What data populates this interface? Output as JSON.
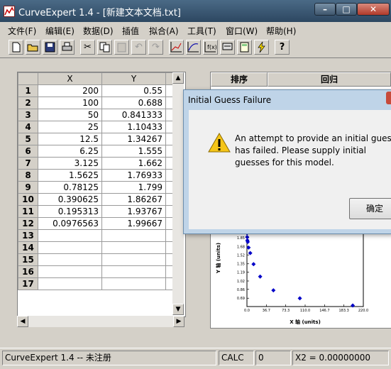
{
  "window": {
    "title": "CurveExpert 1.4 - [新建文本文档.txt]"
  },
  "menu": [
    "文件(F)",
    "编辑(E)",
    "数据(D)",
    "插值",
    "拟合(A)",
    "工具(T)",
    "窗口(W)",
    "帮助(H)"
  ],
  "toolbar": {
    "icons": [
      "new-file-icon",
      "open-folder-icon",
      "save-icon",
      "print-icon",
      "cut-icon",
      "copy-icon",
      "paste-icon",
      "undo-icon",
      "redo-icon",
      "line-plot-icon",
      "curve-plot-icon",
      "fx-plot-icon",
      "settings-plot-icon",
      "calculator-icon",
      "lightning-icon",
      "help-icon"
    ],
    "help_glyph": "?"
  },
  "sheet": {
    "columns": [
      "X",
      "Y"
    ],
    "rows": [
      {
        "n": "1",
        "x": "200",
        "y": "0.55"
      },
      {
        "n": "2",
        "x": "100",
        "y": "0.688"
      },
      {
        "n": "3",
        "x": "50",
        "y": "0.841333"
      },
      {
        "n": "4",
        "x": "25",
        "y": "1.10433"
      },
      {
        "n": "5",
        "x": "12.5",
        "y": "1.34267"
      },
      {
        "n": "6",
        "x": "6.25",
        "y": "1.555"
      },
      {
        "n": "7",
        "x": "3.125",
        "y": "1.662"
      },
      {
        "n": "8",
        "x": "1.5625",
        "y": "1.76933"
      },
      {
        "n": "9",
        "x": "0.78125",
        "y": "1.799"
      },
      {
        "n": "10",
        "x": "0.390625",
        "y": "1.86267"
      },
      {
        "n": "11",
        "x": "0.195313",
        "y": "1.93767"
      },
      {
        "n": "12",
        "x": "0.0976563",
        "y": "1.99667"
      },
      {
        "n": "13",
        "x": "",
        "y": ""
      },
      {
        "n": "14",
        "x": "",
        "y": ""
      },
      {
        "n": "15",
        "x": "",
        "y": ""
      },
      {
        "n": "16",
        "x": "",
        "y": ""
      },
      {
        "n": "17",
        "x": "",
        "y": ""
      }
    ]
  },
  "results_panel": {
    "col_rank": "排序",
    "col_regression": "回归"
  },
  "chart_data": {
    "type": "scatter",
    "xlabel": "X 轴 (units)",
    "ylabel": "Y 轴 (units)",
    "xticks": [
      "0.0",
      "36.7",
      "73.3",
      "110.0",
      "146.7",
      "183.3",
      "220.0"
    ],
    "yticks": [
      "1.85",
      "1.68",
      "1.52",
      "1.35",
      "1.19",
      "1.02",
      "0.86",
      "0.69"
    ],
    "xlim": [
      0,
      220
    ],
    "ylim": [
      0.53,
      1.85
    ],
    "points": [
      {
        "x": 0.0976563,
        "y": 1.99667
      },
      {
        "x": 0.195313,
        "y": 1.93767
      },
      {
        "x": 0.390625,
        "y": 1.86267
      },
      {
        "x": 0.78125,
        "y": 1.799
      },
      {
        "x": 1.5625,
        "y": 1.76933
      },
      {
        "x": 3.125,
        "y": 1.662
      },
      {
        "x": 6.25,
        "y": 1.555
      },
      {
        "x": 12.5,
        "y": 1.34267
      },
      {
        "x": 25,
        "y": 1.10433
      },
      {
        "x": 50,
        "y": 0.841333
      },
      {
        "x": 100,
        "y": 0.688
      },
      {
        "x": 200,
        "y": 0.55
      }
    ],
    "marker_color": "#0000c8"
  },
  "dialog": {
    "title": "Initial Guess Failure",
    "message": "An attempt to provide an initial guess has failed.  Please supply initial guesses for this model.",
    "ok_label": "确定",
    "icon": "warning-icon"
  },
  "status": {
    "app": "CurveExpert 1.4 -- 未注册",
    "mode": "CALC",
    "count": "0",
    "x2": "X2 = 0.00000000"
  }
}
